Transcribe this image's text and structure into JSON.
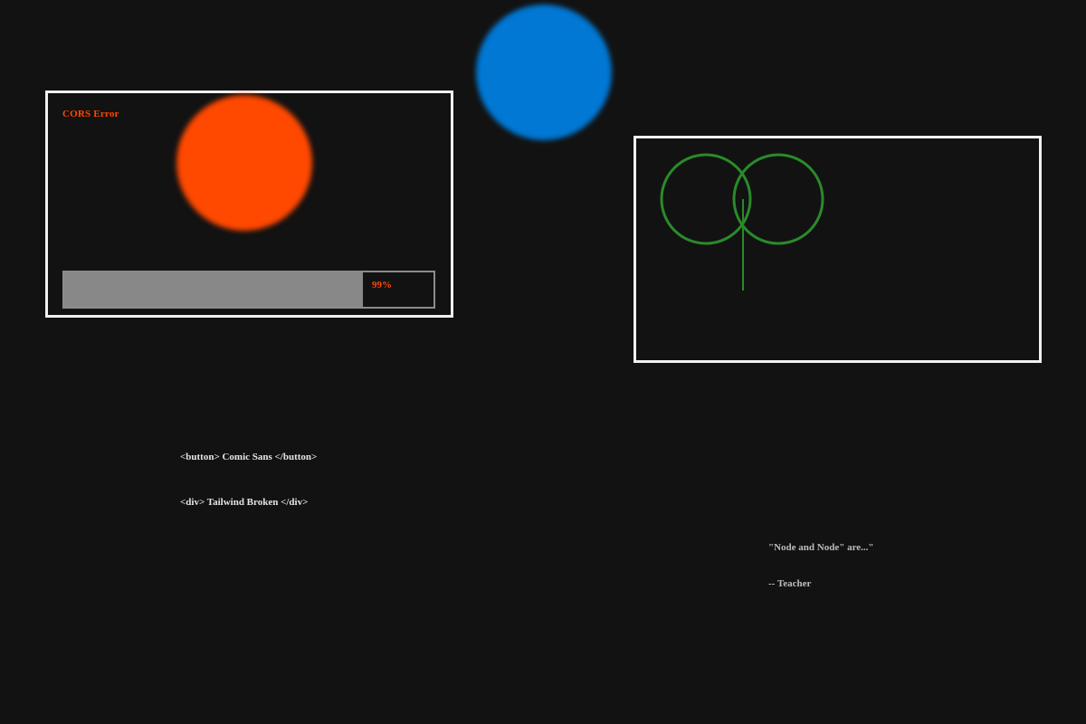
{
  "colors": {
    "background": "#121212",
    "frame": "#f0f0f0",
    "blue_blob": "#0078d4",
    "orange_blob": "#ff4800",
    "error_text": "#ff4800",
    "progress_fill": "#888888",
    "venn_stroke": "#2a8a2a"
  },
  "error_panel": {
    "label": "CORS Error",
    "progress": {
      "value_percent": 81,
      "label": "99%"
    }
  },
  "code_snippets": [
    "<button> Comic Sans </button>",
    "<div> Tailwind Broken </div>"
  ],
  "quote": {
    "text": "\"Node and Node\" are...\"",
    "author": "-- Teacher"
  }
}
